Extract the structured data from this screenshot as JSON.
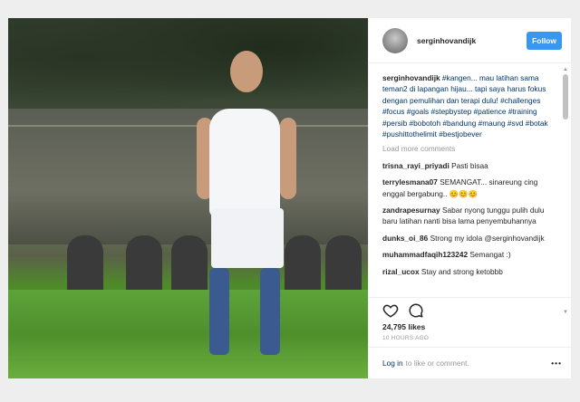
{
  "post": {
    "username": "serginhovandijk",
    "follow_label": "Follow",
    "caption_text": " #kangen... mau latihan sama teman2 di lapangan hijau... tapi saya harus fokus dengan pemulihan dan terapi dulu! #challenges #focus #goals #stepbystep #patience #training #persib #bobotoh #bandung #maung #svd #botak #pushittothelimit #bestjobever",
    "load_more_label": "Load more comments",
    "comments": [
      {
        "user": "trisna_rayi_priyadi",
        "text": "Pasti bisaa"
      },
      {
        "user": "terrylesmana07",
        "text": "SEMANGAT... sinareung cing enggal bergabung.. 😊😊😊"
      },
      {
        "user": "zandrapesurnay",
        "text": "Sabar nyong tunggu pulih dulu baru latihan nanti bisa lama penyembuhannya"
      },
      {
        "user": "dunks_oi_86",
        "text": "Strong my idola @serginhovandijk"
      },
      {
        "user": "muhammadfaqih123242",
        "text": "Semangat :)"
      },
      {
        "user": "rizal_ucox",
        "text": "Stay and strong ketobbb"
      }
    ],
    "likes": "24,795 likes",
    "time": "10 HOURS AGO",
    "login_link": "Log in",
    "login_text": "to like or comment.",
    "more_label": "•••"
  },
  "icons": [
    "heart-icon",
    "comment-icon",
    "more-options-icon"
  ]
}
